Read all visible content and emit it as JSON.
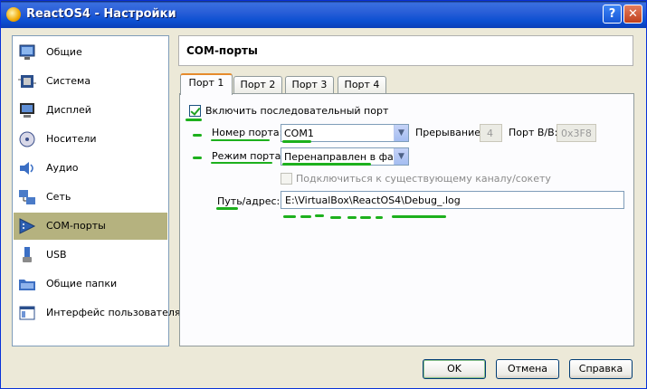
{
  "window": {
    "title": "ReactOS4 - Настройки",
    "help_glyph": "?",
    "close_glyph": "✕"
  },
  "sidebar": {
    "items": [
      {
        "label": "Общие",
        "icon": "general-monitor-icon"
      },
      {
        "label": "Система",
        "icon": "system-chip-icon"
      },
      {
        "label": "Дисплей",
        "icon": "display-icon"
      },
      {
        "label": "Носители",
        "icon": "storage-disk-icon"
      },
      {
        "label": "Аудио",
        "icon": "audio-speaker-icon"
      },
      {
        "label": "Сеть",
        "icon": "network-icon"
      },
      {
        "label": "COM-порты",
        "icon": "serial-port-icon",
        "selected": true
      },
      {
        "label": "USB",
        "icon": "usb-icon"
      },
      {
        "label": "Общие папки",
        "icon": "shared-folder-icon"
      },
      {
        "label": "Интерфейс пользователя",
        "icon": "user-interface-icon"
      }
    ]
  },
  "main": {
    "title": "COM-порты",
    "tabs": [
      {
        "label": "Порт 1",
        "active": true
      },
      {
        "label": "Порт 2"
      },
      {
        "label": "Порт 3"
      },
      {
        "label": "Порт 4"
      }
    ],
    "enable": {
      "label": "Включить последовательный порт",
      "checked": true
    },
    "port_number": {
      "label": "Номер порта:",
      "value": "COM1"
    },
    "irq": {
      "label": "Прерывание:",
      "value": "4"
    },
    "io_port": {
      "label": "Порт В/В:",
      "value": "0x3F8"
    },
    "port_mode": {
      "label": "Режим порта:",
      "value": "Перенаправлен в файл"
    },
    "connect_existing": {
      "label": "Подключиться к существующему каналу/сокету",
      "checked": false
    },
    "path": {
      "label": "Путь/адрес:",
      "value": "E:\\VirtualBox\\ReactOS4\\Debug_.log"
    }
  },
  "buttons": {
    "ok": "OK",
    "cancel": "Отмена",
    "help": "Справка"
  },
  "colors": {
    "selection": "#b5b27f",
    "annotation": "#1db01d",
    "titlebar": "#0b4fd1"
  }
}
